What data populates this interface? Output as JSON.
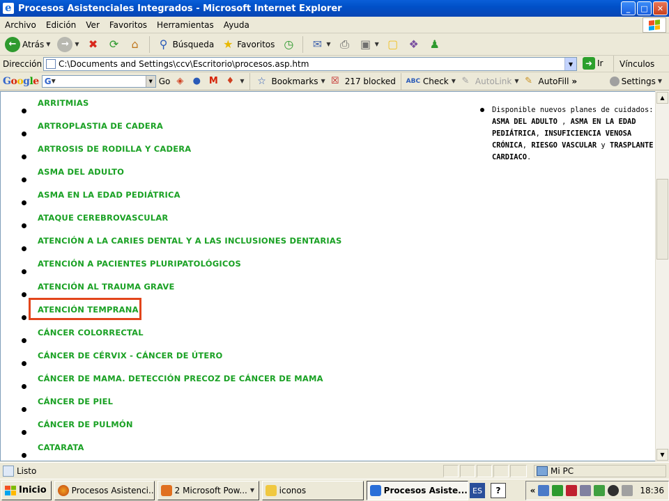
{
  "window": {
    "title": "Procesos Asistenciales Integrados - Microsoft Internet Explorer",
    "controls": [
      "_",
      "□",
      "✕"
    ]
  },
  "menu": [
    "Archivo",
    "Edición",
    "Ver",
    "Favoritos",
    "Herramientas",
    "Ayuda"
  ],
  "toolbar": {
    "back_label": "Atrás",
    "search_label": "Búsqueda",
    "favorites_label": "Favoritos"
  },
  "address": {
    "label": "Dirección",
    "url": "C:\\Documents and Settings\\ccv\\Escritorio\\procesos.asp.htm",
    "go_label": "Ir",
    "links_label": "Vínculos"
  },
  "googlebar": {
    "logo": "Google",
    "go_label": "Go",
    "bookmarks_label": "Bookmarks",
    "blocked_label": "217 blocked",
    "check_label": "Check",
    "autolink_label": "AutoLink",
    "autofill_label": "AutoFill",
    "settings_label": "Settings"
  },
  "processes": [
    "ARRITMIAS",
    "ARTROPLASTIA DE CADERA",
    "ARTROSIS DE RODILLA Y CADERA",
    "ASMA DEL ADULTO",
    "ASMA EN LA EDAD PEDIÁTRICA",
    "ATAQUE CEREBROVASCULAR",
    "ATENCIÓN A LA CARIES DENTAL Y A LAS INCLUSIONES DENTARIAS",
    "ATENCIÓN A PACIENTES PLURIPATOLÓGICOS",
    "ATENCIÓN AL TRAUMA GRAVE",
    "ATENCIÓN TEMPRANA",
    "CÁNCER COLORRECTAL",
    "CÁNCER DE CÉRVIX - CÁNCER DE ÚTERO",
    "CÁNCER DE MAMA. DETECCIÓN PRECOZ DE CÁNCER DE MAMA",
    "CÁNCER DE PIEL",
    "CÁNCER DE PULMÓN",
    "CATARATA"
  ],
  "highlighted_item": "ATENCIÓN TEMPRANA",
  "notice": {
    "intro": "Disponible nuevos planes de cuidados:",
    "items": [
      "ASMA DEL ADULTO",
      "ASMA EN LA EDAD PEDIÁTRICA",
      "INSUFICIENCIA VENOSA CRÓNICA",
      "RIESGO VASCULAR",
      "TRASPLANTE CARDIACO"
    ],
    "sep1": " , ",
    "sep2": ", ",
    "sep3": ", ",
    "sep4": " y ",
    "end": "."
  },
  "status": {
    "text": "Listo",
    "zone": "Mi PC"
  },
  "taskbar": {
    "start_label": "Inicio",
    "tasks": [
      "Procesos Asistenci...",
      "2 Microsoft Pow...",
      "iconos",
      "Procesos Asiste..."
    ],
    "lang": "ES",
    "help": "?",
    "chevron": "«",
    "time": "18:36"
  },
  "colors": {
    "link": "#1aa124",
    "highlight_border": "#e2451b",
    "titlebar": "#0a5fd8"
  }
}
